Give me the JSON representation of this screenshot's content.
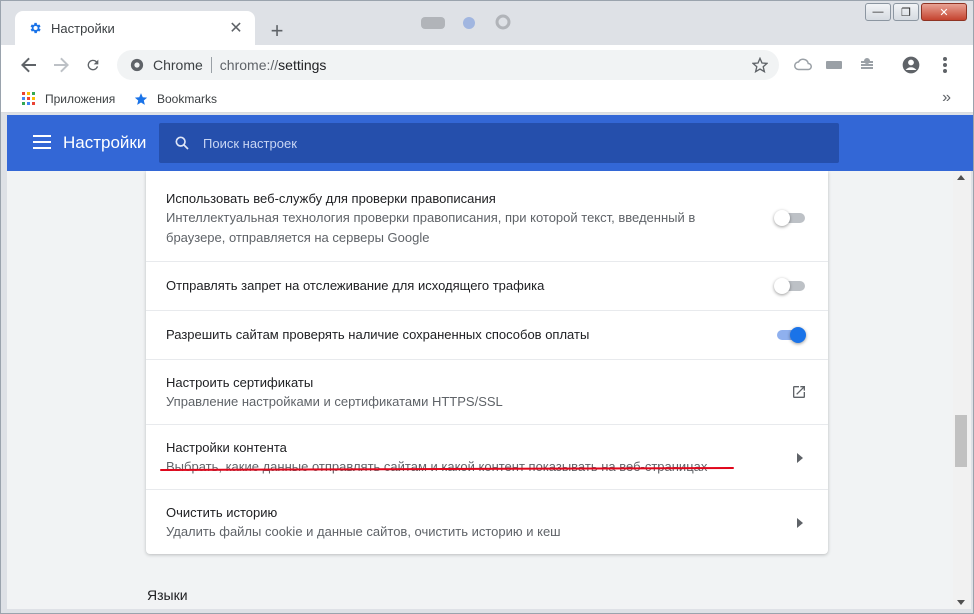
{
  "tab": {
    "title": "Настройки"
  },
  "toolbar": {
    "omnibox_site": "Chrome",
    "omnibox_url_scheme": "chrome://",
    "omnibox_url_path": "settings"
  },
  "bookmarks": {
    "apps_label": "Приложения",
    "bookmarks_label": "Bookmarks"
  },
  "header": {
    "title": "Настройки",
    "search_placeholder": "Поиск настроек"
  },
  "settings": {
    "rows": [
      {
        "label": "Использовать веб-службу для проверки правописания",
        "sub": "Интеллектуальная технология проверки правописания, при которой текст, введенный в браузере, отправляется на серверы Google",
        "control": "toggle",
        "on": false
      },
      {
        "label": "Отправлять запрет на отслеживание для исходящего трафика",
        "control": "toggle",
        "on": false
      },
      {
        "label": "Разрешить сайтам проверять наличие сохраненных способов оплаты",
        "control": "toggle",
        "on": true
      },
      {
        "label": "Настроить сертификаты",
        "sub": "Управление настройками и сертификатами HTTPS/SSL",
        "control": "external-link"
      },
      {
        "label": "Настройки контента",
        "sub": "Выбрать, какие данные отправлять сайтам и какой контент показывать на веб-страницах",
        "control": "arrow",
        "annotation": "red-underline"
      },
      {
        "label": "Очистить историю",
        "sub": "Удалить файлы cookie и данные сайтов, очистить историю и кеш",
        "control": "arrow"
      }
    ],
    "next_section_title": "Языки"
  },
  "colors": {
    "header_bg": "#3367d6",
    "search_bg": "#254fac",
    "toggle_on": "#1a73e8",
    "annotation_red": "#e0061b"
  }
}
